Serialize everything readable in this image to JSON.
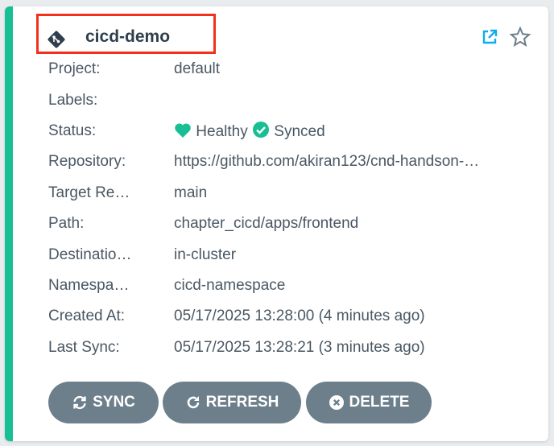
{
  "app": {
    "name": "cicd-demo",
    "icon": "git-icon"
  },
  "header_actions": {
    "external_link_icon": "external-link-icon",
    "favorite_icon": "star-icon"
  },
  "fields": {
    "project": {
      "label": "Project:",
      "value": "default"
    },
    "labels": {
      "label": "Labels:",
      "value": ""
    },
    "status": {
      "label": "Status:",
      "health": "Healthy",
      "sync": "Synced",
      "health_icon": "heart-icon",
      "sync_icon": "check-circle-icon"
    },
    "repository": {
      "label": "Repository:",
      "value": "https://github.com/akiran123/cnd-handson-…"
    },
    "target_revision": {
      "label": "Target Re…",
      "value": "main"
    },
    "path": {
      "label": "Path:",
      "value": "chapter_cicd/apps/frontend"
    },
    "destination": {
      "label": "Destinatio…",
      "value": "in-cluster"
    },
    "namespace": {
      "label": "Namespa…",
      "value": "cicd-namespace"
    },
    "created_at": {
      "label": "Created At:",
      "value": "05/17/2025 13:28:00  (4 minutes ago)"
    },
    "last_sync": {
      "label": "Last Sync:",
      "value": "05/17/2025 13:28:21  (3 minutes ago)"
    }
  },
  "buttons": {
    "sync": {
      "label": "SYNC",
      "icon": "sync-icon"
    },
    "refresh": {
      "label": "REFRESH",
      "icon": "refresh-icon"
    },
    "delete": {
      "label": "DELETE",
      "icon": "close-circle-icon"
    }
  },
  "colors": {
    "status_bar": "#18be94",
    "healthy": "#18be94",
    "synced": "#18be94",
    "button_bg": "#6d7f8b",
    "highlight": "#f2301c",
    "link_icon": "#0dadea"
  }
}
